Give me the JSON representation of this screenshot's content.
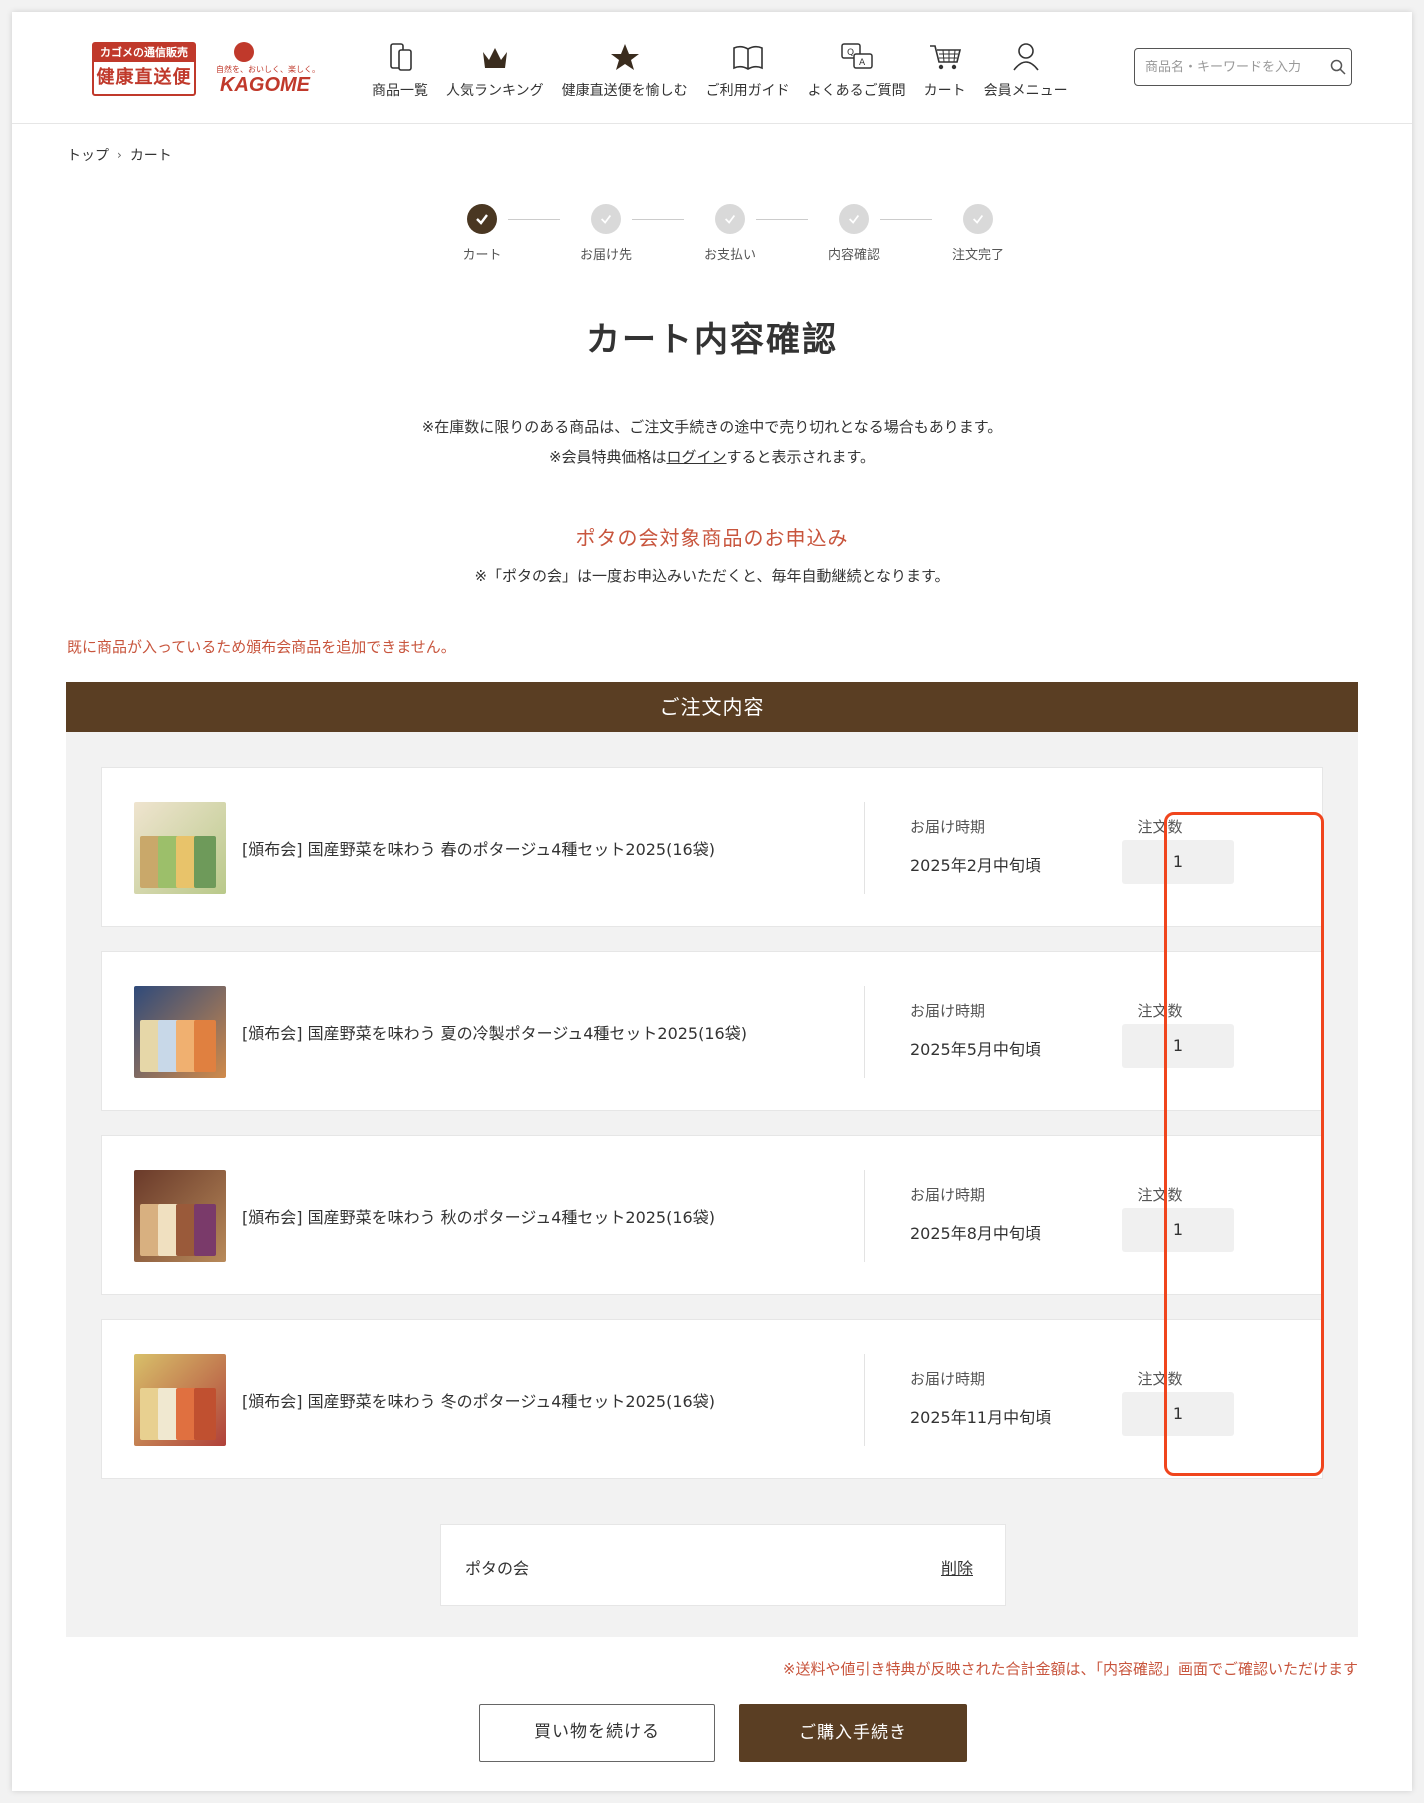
{
  "brand": {
    "logo_top": "カゴメの通信販売",
    "logo_bottom": "健康直送便",
    "kagome_tagline": "自然を、おいしく、楽しく。",
    "kagome_word": "KAGOME",
    "accent_color": "#c0392b"
  },
  "nav": [
    {
      "label": "商品一覧",
      "icon": "product-list-icon"
    },
    {
      "label": "人気ランキング",
      "icon": "crown-icon"
    },
    {
      "label": "健康直送便を愉しむ",
      "icon": "star-icon"
    },
    {
      "label": "ご利用ガイド",
      "icon": "book-icon"
    },
    {
      "label": "よくあるご質問",
      "icon": "qa-icon"
    },
    {
      "label": "カート",
      "icon": "cart-icon"
    },
    {
      "label": "会員メニュー",
      "icon": "user-icon"
    }
  ],
  "search": {
    "placeholder": "商品名・キーワードを入力"
  },
  "breadcrumb": {
    "home": "トップ",
    "current": "カート"
  },
  "steps": [
    {
      "label": "カート",
      "active": true
    },
    {
      "label": "お届け先",
      "active": false
    },
    {
      "label": "お支払い",
      "active": false
    },
    {
      "label": "内容確認",
      "active": false
    },
    {
      "label": "注文完了",
      "active": false
    }
  ],
  "page_title": "カート内容確認",
  "notice_1": "※在庫数に限りのある商品は、ご注文手続きの途中で売り切れとなる場合もあります。",
  "notice_2_prefix": "※会員特典価格は",
  "notice_2_link": "ログイン",
  "notice_2_suffix": "すると表示されます。",
  "club_heading": "ポタの会対象商品のお申込み",
  "club_notice": "※「ポタの会」は一度お申込みいただくと、毎年自動継続となります。",
  "error_message": "既に商品が入っているため頒布会商品を追加できません。",
  "order_header": "ご注文内容",
  "items": [
    {
      "name": "[頒布会] 国産野菜を味わう 春のポタージュ4種セット2025(16袋)",
      "delivery_label": "お届け時期",
      "delivery": "2025年2月中旬頃",
      "qty_label": "注文数",
      "qty": "1"
    },
    {
      "name": "[頒布会] 国産野菜を味わう 夏の冷製ポタージュ4種セット2025(16袋)",
      "delivery_label": "お届け時期",
      "delivery": "2025年5月中旬頃",
      "qty_label": "注文数",
      "qty": "1"
    },
    {
      "name": "[頒布会] 国産野菜を味わう 秋のポタージュ4種セット2025(16袋)",
      "delivery_label": "お届け時期",
      "delivery": "2025年8月中旬頃",
      "qty_label": "注文数",
      "qty": "1"
    },
    {
      "name": "[頒布会] 国産野菜を味わう 冬のポタージュ4種セット2025(16袋)",
      "delivery_label": "お届け時期",
      "delivery": "2025年11月中旬頃",
      "qty_label": "注文数",
      "qty": "1"
    }
  ],
  "club": {
    "name": "ポタの会",
    "delete_label": "削除"
  },
  "shipping_note": "※送料や値引き特典が反映された合計金額は、「内容確認」画面でご確認いただけます",
  "buttons": {
    "continue": "買い物を続ける",
    "checkout": "ご購入手続き"
  },
  "colors": {
    "brown": "#5a3e23",
    "alert": "#c8553d",
    "highlight": "#f0451d"
  }
}
